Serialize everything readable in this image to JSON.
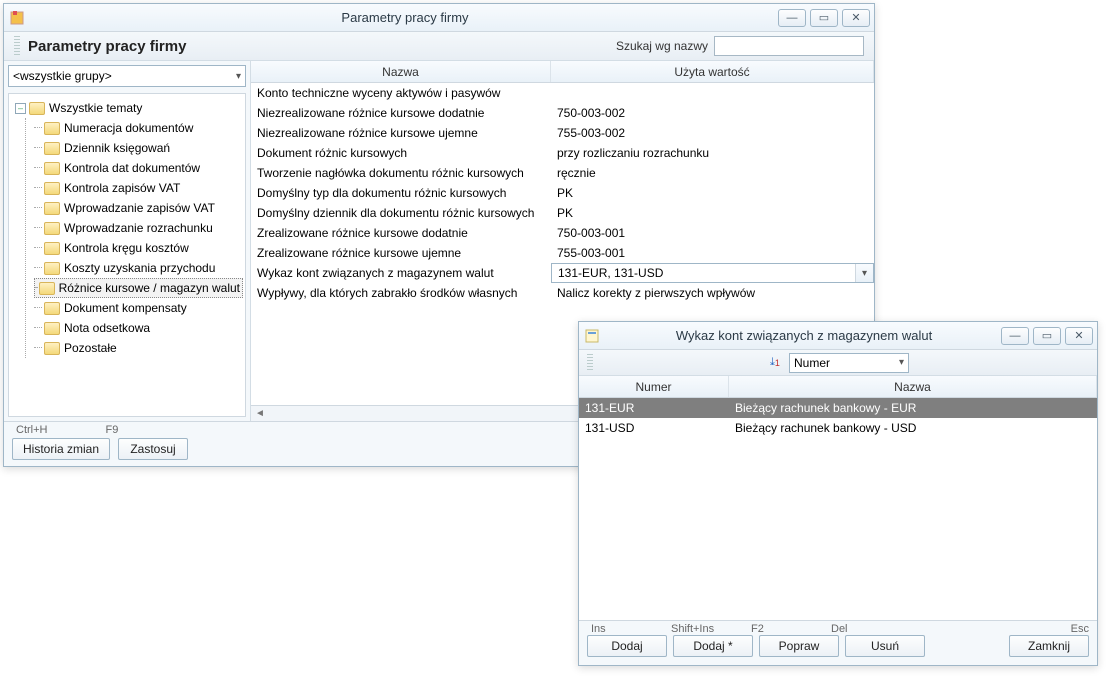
{
  "window1": {
    "title": "Parametry pracy firmy",
    "heading": "Parametry pracy firmy",
    "search_label": "Szukaj wg nazwy",
    "group_combo": "<wszystkie grupy>",
    "tree_root": "Wszystkie tematy",
    "tree_items": [
      "Numeracja dokumentów",
      "Dziennik księgowań",
      "Kontrola dat dokumentów",
      "Kontrola zapisów VAT",
      "Wprowadzanie zapisów VAT",
      "Wprowadzanie rozrachunku",
      "Kontrola kręgu kosztów",
      "Koszty uzyskania przychodu",
      "Różnice kursowe / magazyn walut",
      "Dokument kompensaty",
      "Nota odsetkowa",
      "Pozostałe"
    ],
    "selected_tree_index": 8,
    "columns": {
      "name": "Nazwa",
      "value": "Użyta wartość"
    },
    "rows": [
      {
        "name": "Konto techniczne wyceny aktywów i pasywów",
        "value": ""
      },
      {
        "name": "Niezrealizowane różnice kursowe dodatnie",
        "value": "750-003-002"
      },
      {
        "name": "Niezrealizowane różnice kursowe ujemne",
        "value": "755-003-002"
      },
      {
        "name": "Dokument różnic kursowych",
        "value": "przy rozliczaniu rozrachunku"
      },
      {
        "name": "Tworzenie nagłówka dokumentu różnic kursowych",
        "value": "ręcznie"
      },
      {
        "name": "Domyślny typ dla dokumentu różnic kursowych",
        "value": "PK"
      },
      {
        "name": "Domyślny dziennik dla dokumentu różnic kursowych",
        "value": "PK"
      },
      {
        "name": "Zrealizowane różnice kursowe dodatnie",
        "value": "750-003-001"
      },
      {
        "name": "Zrealizowane różnice kursowe ujemne",
        "value": "755-003-001"
      },
      {
        "name": "Wykaz kont związanych z magazynem walut",
        "value": "131-EUR, 131-USD",
        "editable": true
      },
      {
        "name": "Wypływy, dla których zabrakło środków własnych",
        "value": "Nalicz korekty z pierwszych wpływów"
      }
    ],
    "footer": {
      "shortcut_history": "Ctrl+H",
      "shortcut_apply": "F9",
      "btn_history": "Historia zmian",
      "btn_apply": "Zastosuj"
    }
  },
  "window2": {
    "title": "Wykaz kont związanych z magazynem walut",
    "sort_label": "Numer",
    "columns": {
      "num": "Numer",
      "name": "Nazwa"
    },
    "rows": [
      {
        "num": "131-EUR",
        "name": "Bieżący rachunek bankowy - EUR",
        "selected": true
      },
      {
        "num": "131-USD",
        "name": "Bieżący rachunek bankowy - USD",
        "selected": false
      }
    ],
    "footer": {
      "sc_add": "Ins",
      "sc_add2": "Shift+Ins",
      "sc_edit": "F2",
      "sc_del": "Del",
      "sc_close": "Esc",
      "btn_add": "Dodaj",
      "btn_add2": "Dodaj *",
      "btn_edit": "Popraw",
      "btn_del": "Usuń",
      "btn_close": "Zamknij"
    }
  }
}
